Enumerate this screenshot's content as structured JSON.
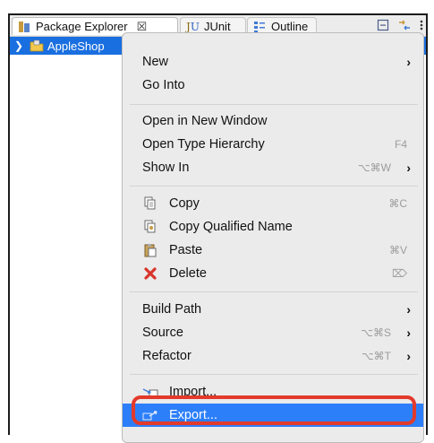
{
  "tabs": [
    {
      "label": "Package Explorer",
      "icon": "package-explorer-icon",
      "close": "☒"
    },
    {
      "label": "JUnit",
      "icon": "junit-icon"
    },
    {
      "label": "Outline",
      "icon": "outline-icon"
    }
  ],
  "tree": {
    "project": "AppleShop"
  },
  "menu": {
    "new": "New",
    "go_into": "Go Into",
    "open_new_window": "Open in New Window",
    "open_type_hierarchy": "Open Type Hierarchy",
    "open_type_hierarchy_shortcut": "F4",
    "show_in": "Show In",
    "show_in_shortcut": "⌥⌘W",
    "copy": "Copy",
    "copy_shortcut": "⌘C",
    "copy_qualified": "Copy Qualified Name",
    "paste": "Paste",
    "paste_shortcut": "⌘V",
    "delete": "Delete",
    "delete_shortcut": "⌦",
    "build_path": "Build Path",
    "source": "Source",
    "source_shortcut": "⌥⌘S",
    "refactor": "Refactor",
    "refactor_shortcut": "⌥⌘T",
    "import": "Import...",
    "export": "Export..."
  },
  "colors": {
    "selection": "#1a6fe0",
    "menu_highlight": "#2d7ff9",
    "annotation": "#e23a2b"
  }
}
